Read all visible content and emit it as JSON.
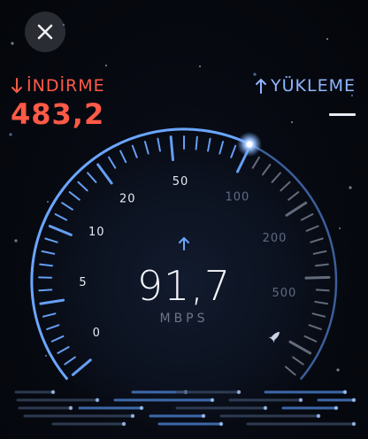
{
  "download": {
    "label": "İNDİRME",
    "value": "483,2",
    "icon": "arrow-down-icon",
    "color": "#ff5a47"
  },
  "upload": {
    "label": "YÜKLEME",
    "value": "—",
    "icon": "arrow-up-icon",
    "color": "#8fb6ff"
  },
  "gauge": {
    "reading": "91,7",
    "unit": "MBPS",
    "scale_labels_left": [
      "0",
      "5",
      "10",
      "20",
      "50"
    ],
    "scale_labels_right": [
      "100",
      "200",
      "500"
    ],
    "accent_color": "#6aa6ff"
  },
  "icons": {
    "close": "close-icon",
    "rocket": "rocket-icon",
    "center_arrow": "arrow-up-icon"
  }
}
